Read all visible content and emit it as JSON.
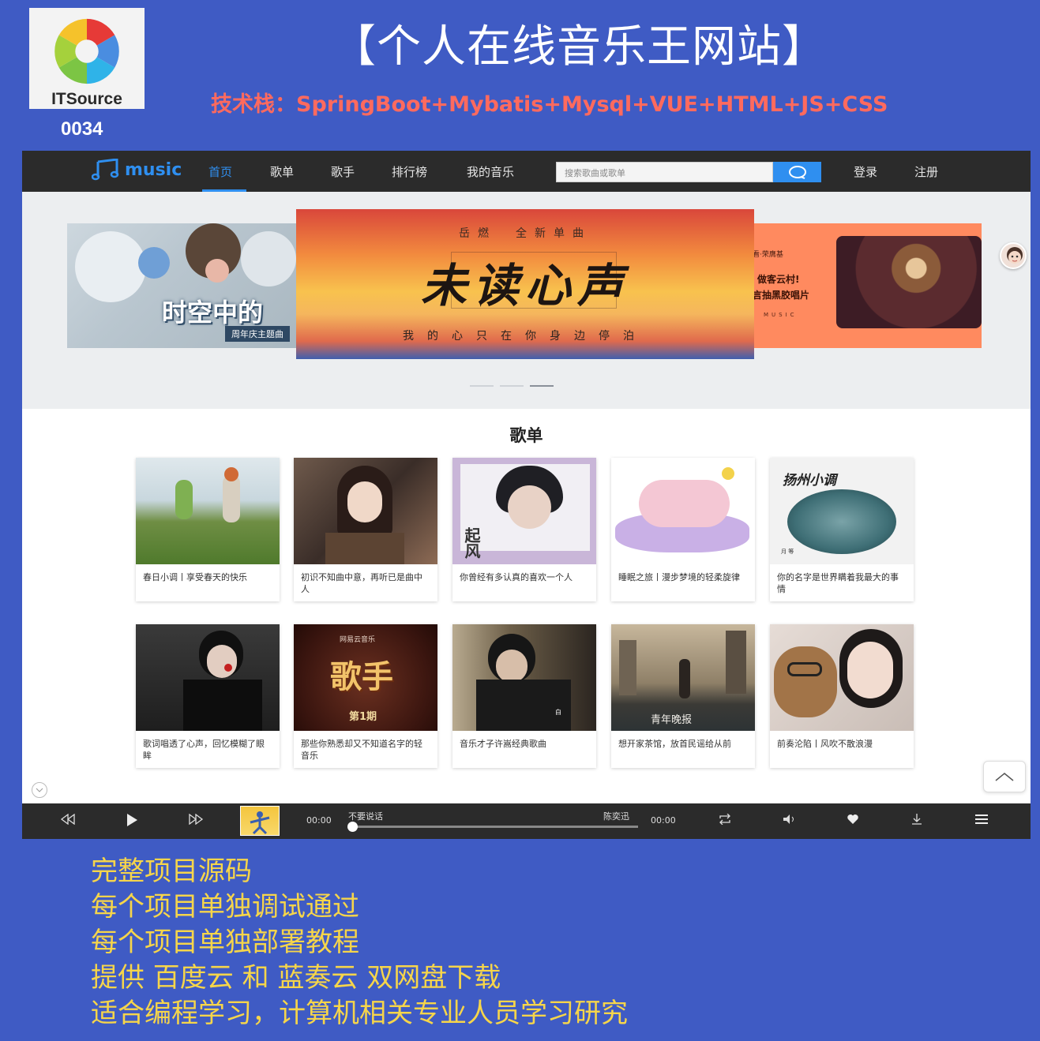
{
  "poster": {
    "logo_text": "ITSource",
    "code": "0034",
    "title": "【个人在线音乐王网站】",
    "tech_stack": "技术栈：SpringBoot+Mybatis+Mysql+VUE+HTML+JS+CSS",
    "features": [
      "完整项目源码",
      "每个项目单独调试通过",
      "每个项目单独部署教程",
      "提供 百度云 和 蓝奏云 双网盘下载",
      "适合编程学习，计算机相关专业人员学习研究"
    ]
  },
  "navbar": {
    "brand": "music",
    "items": [
      "首页",
      "歌单",
      "歌手",
      "排行榜",
      "我的音乐"
    ],
    "search_placeholder": "搜索歌曲或歌单",
    "login": "登录",
    "register": "注册"
  },
  "banner": {
    "left_text": "时空中的",
    "left_sub": "周年庆主题曲",
    "center_top": "岳燃　全新单曲",
    "center_callig": "未读心声",
    "center_bottom": "我的心只在你身边停泊",
    "right_label": "看·荣膺基",
    "right_line1": "做客云村!",
    "right_line2": "言抽黑胶唱片",
    "right_music": "MUSIC"
  },
  "section": {
    "title": "歌单"
  },
  "playlists": [
    {
      "title": "春日小调丨享受春天的快乐"
    },
    {
      "title": "初识不知曲中意，再听已是曲中人"
    },
    {
      "title": "你曾经有多认真的喜欢一个人",
      "cover_text": "起风"
    },
    {
      "title": "睡眠之旅丨漫步梦境的轻柔旋律"
    },
    {
      "title": "你的名字是世界瞒着我最大的事情",
      "cover_text": "扬州小调",
      "cover_sub": "月 等"
    },
    {
      "title": "歌词唱透了心声，回忆模糊了眼眸"
    },
    {
      "title": "那些你熟悉却又不知道名字的轻音乐",
      "cover_text": "歌手",
      "cover_brand": "网易云音乐",
      "cover_sub": "第1期"
    },
    {
      "title": "音乐才子许嵩经典歌曲",
      "cover_sub": "白"
    },
    {
      "title": "想开家茶馆，放首民谣给从前",
      "cover_text": "青年晚报"
    },
    {
      "title": "前奏沦陷丨风吹不散浪漫"
    }
  ],
  "player": {
    "current_time": "00:00",
    "total_time": "00:00",
    "song": "不要说话",
    "artist": "陈奕迅",
    "progress": 0.0
  }
}
